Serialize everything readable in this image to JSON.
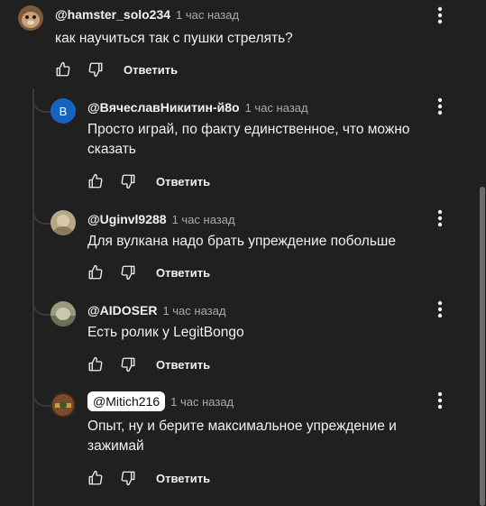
{
  "comment": {
    "author": "@hamster_solo234",
    "time": "1 час назад",
    "text": "как научиться так с пушки стрелять?",
    "reply_label": "Ответить"
  },
  "replies": [
    {
      "author": "@ВячеславНикитин-й8о",
      "avatar_letter": "В",
      "time": "1 час назад",
      "text": "Просто играй, по факту единственное, что можно сказать",
      "reply_label": "Ответить"
    },
    {
      "author": "@Uginvl9288",
      "time": "1 час назад",
      "text": "Для вулкана надо брать упреждение побольше",
      "reply_label": "Ответить"
    },
    {
      "author": "@AIDOSER",
      "time": "1 час назад",
      "text": "Есть ролик у LegitBongo",
      "reply_label": "Ответить"
    },
    {
      "author": "@Mitich216",
      "time": "1 час назад",
      "text": "Опыт, ну и берите максимальное упреждение и зажимай",
      "reply_label": "Ответить"
    }
  ],
  "colors": {
    "background": "#202020",
    "text": "#f1f1f1",
    "secondary": "#aaaaaa",
    "avatar_blue": "#1565c0"
  }
}
